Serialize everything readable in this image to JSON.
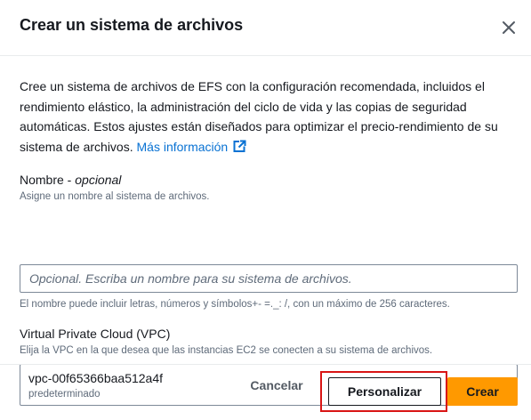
{
  "dialog": {
    "title": "Crear un sistema de archivos",
    "close_icon": "close-icon"
  },
  "body": {
    "description": "Cree un sistema de archivos de EFS con la configuración recomendada, incluidos el rendimiento elástico, la administración del ciclo de vida y las copias de seguridad automáticas. Estos ajustes están diseñados para optimizar el precio-rendimiento de su sistema de archivos.",
    "more_info_link": "Más información",
    "external_link_icon": "external-link-icon"
  },
  "name_field": {
    "label": "Nombre",
    "label_separator": " - ",
    "optional_tag": "opcional",
    "description": "Asigne un nombre al sistema de archivos.",
    "value": "",
    "placeholder": "Opcional. Escriba un nombre para su sistema de archivos.",
    "constraint": "El nombre puede incluir letras, números y símbolos+- =._: /, con un máximo de 256 caracteres."
  },
  "vpc_field": {
    "label": "Virtual Private Cloud (VPC)",
    "description": "Elija la VPC en la que desea que las instancias EC2 se conecten a su sistema de archivos.",
    "selected_value": "vpc-00f65366baa512a4f",
    "selected_description": "predeterminado",
    "caret_icon": "caret-down-icon"
  },
  "footer": {
    "cancel_label": "Cancelar",
    "customize_label": "Personalizar",
    "create_label": "Crear",
    "highlight_color": "#d91515",
    "primary_color": "#ff9900"
  }
}
